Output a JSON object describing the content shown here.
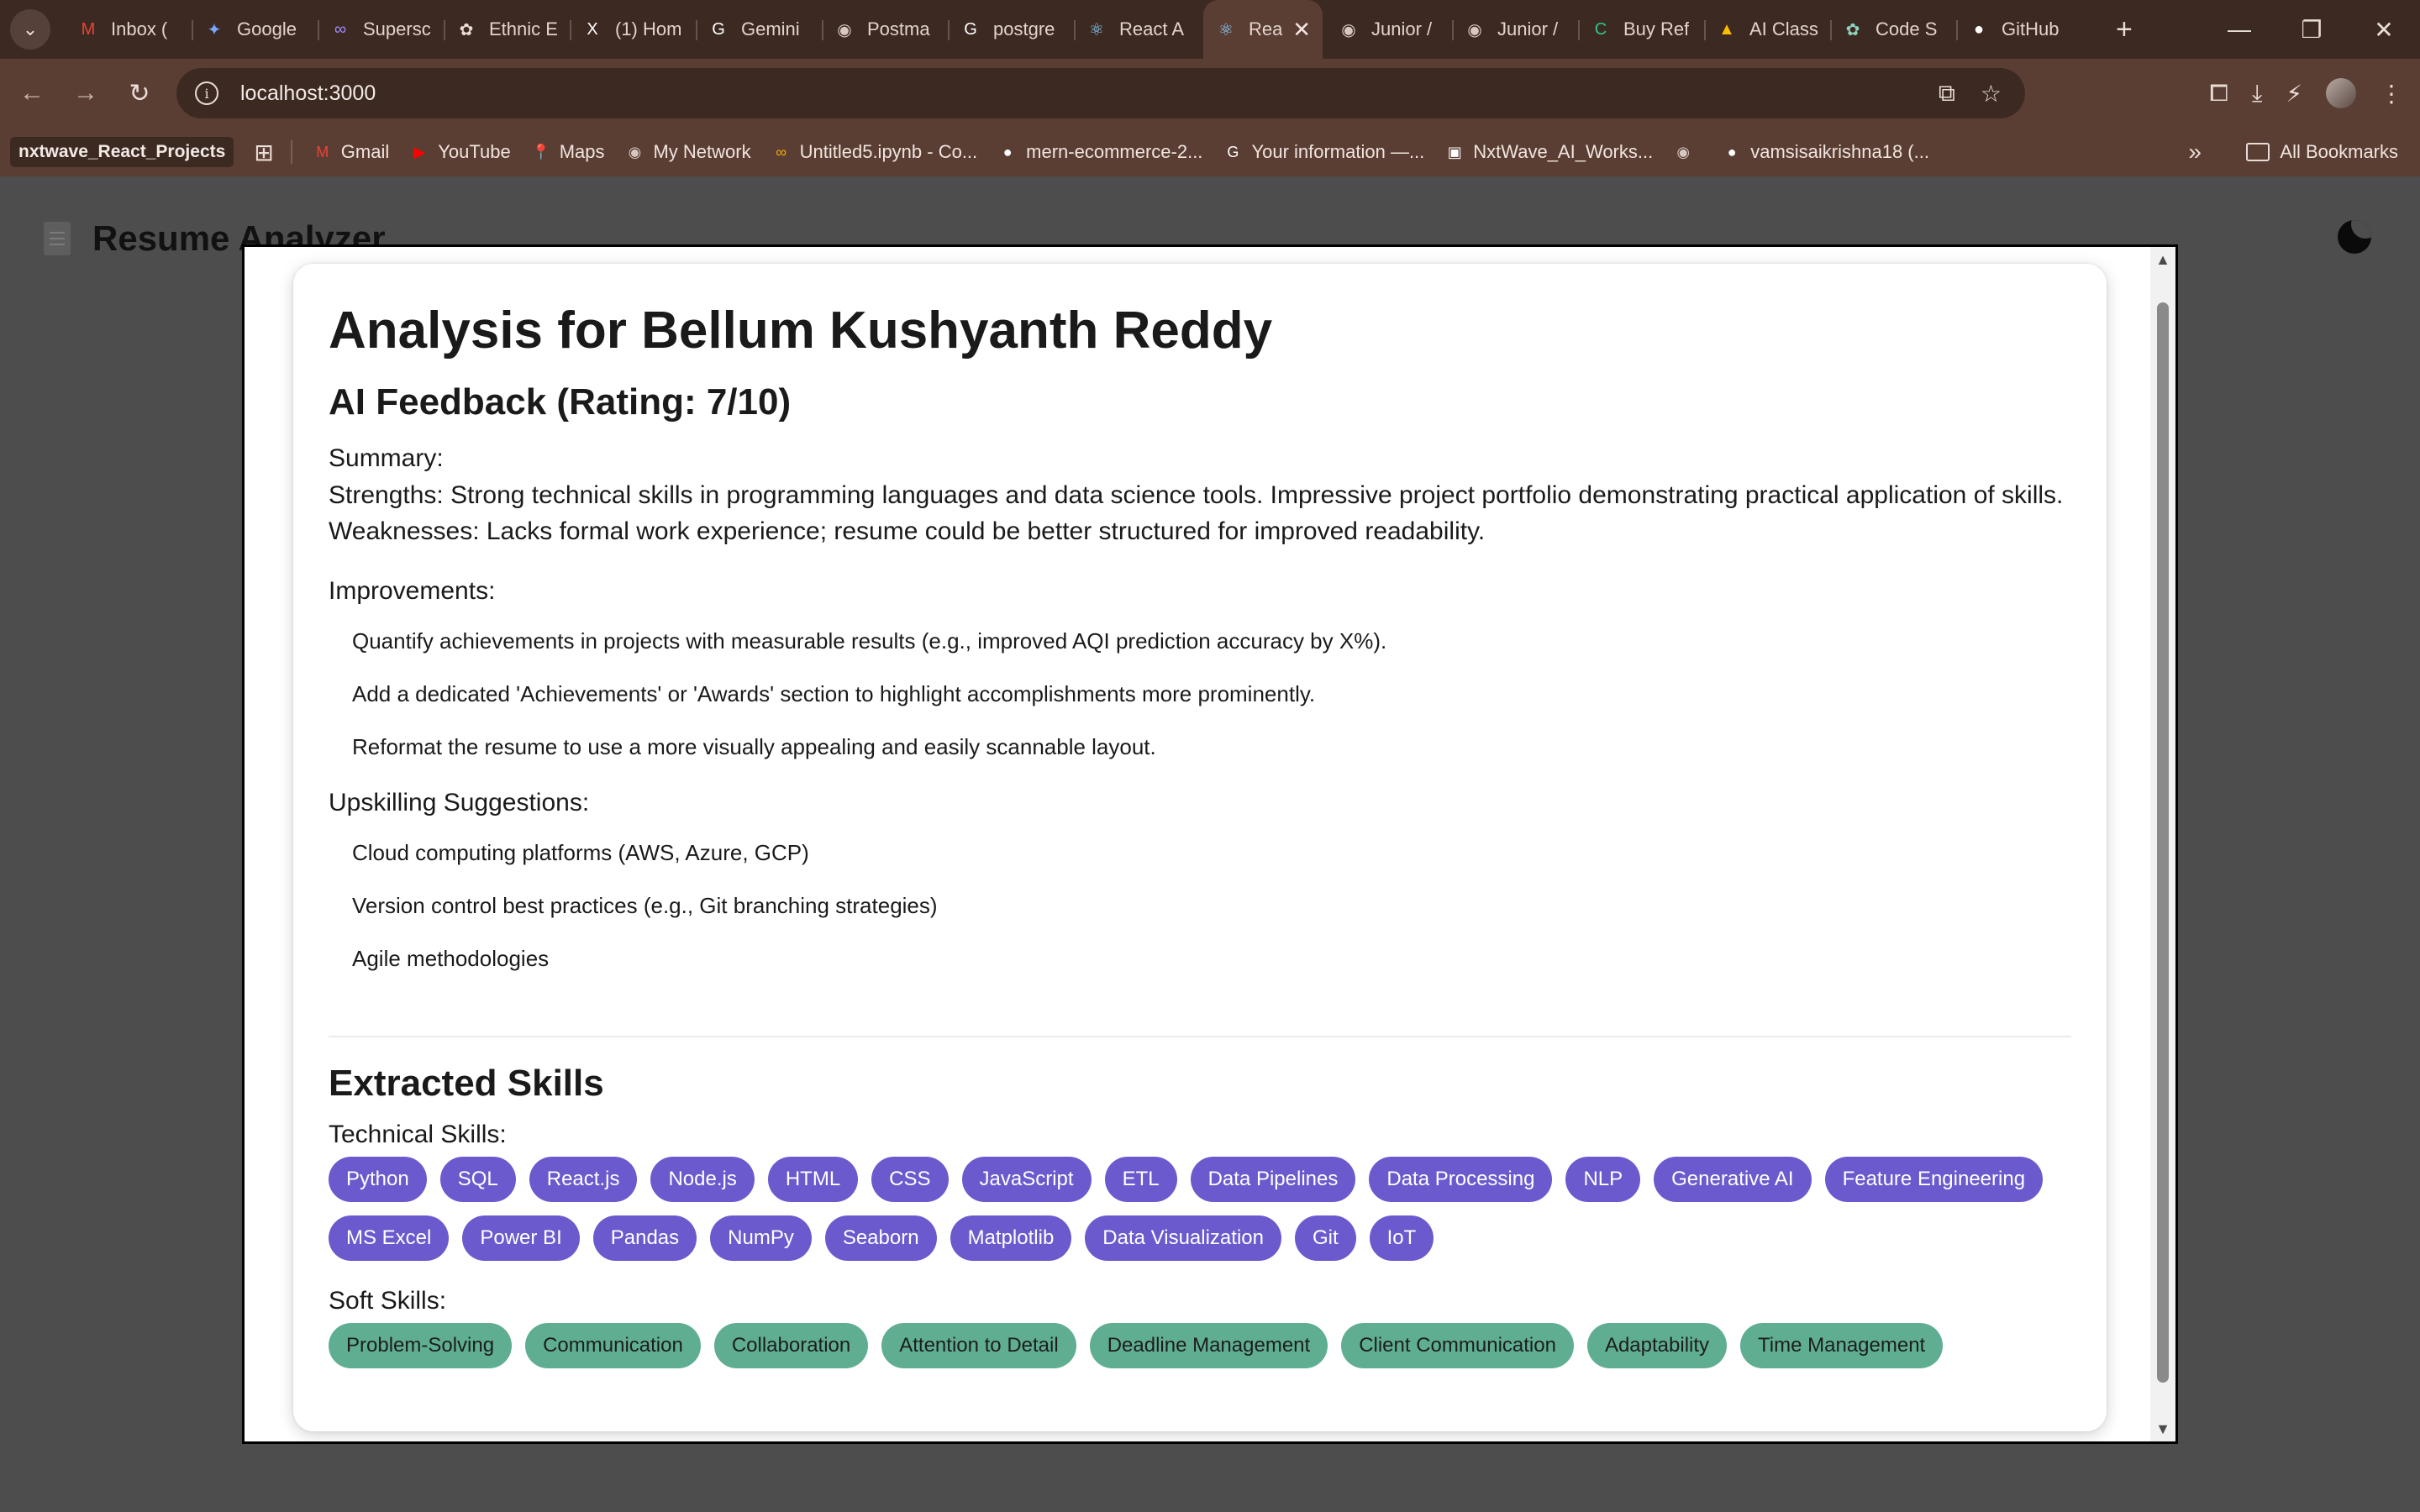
{
  "browser": {
    "tabs": [
      {
        "title": "Inbox (",
        "icon": "gmail-icon",
        "glyph": "M",
        "color": "#ea4335"
      },
      {
        "title": "Google",
        "icon": "gemini-star-icon",
        "glyph": "✦",
        "color": "#7aa7ff"
      },
      {
        "title": "Supersc",
        "icon": "link-icon",
        "glyph": "∞",
        "color": "#9b8cff"
      },
      {
        "title": "Ethnic E",
        "icon": "openai-icon",
        "glyph": "✿",
        "color": "#e9dcd6"
      },
      {
        "title": "(1) Hom",
        "icon": "x-icon",
        "glyph": "X",
        "color": "#ffffff"
      },
      {
        "title": "Gemini",
        "icon": "google-icon",
        "glyph": "G",
        "color": "#ffffff"
      },
      {
        "title": "Postma",
        "icon": "globe-icon",
        "glyph": "◉",
        "color": "#d8c8c1"
      },
      {
        "title": "postgre",
        "icon": "google-icon",
        "glyph": "G",
        "color": "#ffffff"
      },
      {
        "title": "React A",
        "icon": "react-icon",
        "glyph": "⚛",
        "color": "#8fd3ff"
      },
      {
        "title": "Rea",
        "icon": "react-icon",
        "glyph": "⚛",
        "color": "#8fd3ff",
        "active": true
      },
      {
        "title": "Junior /",
        "icon": "globe-icon",
        "glyph": "◉",
        "color": "#d8c8c1"
      },
      {
        "title": "Junior /",
        "icon": "globe-icon",
        "glyph": "◉",
        "color": "#d8c8c1"
      },
      {
        "title": "Buy Ref",
        "icon": "grammarly-icon",
        "glyph": "C",
        "color": "#2fc38e"
      },
      {
        "title": "AI Class",
        "icon": "drive-icon",
        "glyph": "▲",
        "color": "#fbbc04"
      },
      {
        "title": "Code S",
        "icon": "openai-icon",
        "glyph": "✿",
        "color": "#8fd3c0"
      },
      {
        "title": "GitHub",
        "icon": "github-icon",
        "glyph": "●",
        "color": "#ffffff",
        "wide": true
      }
    ],
    "url": "localhost:3000",
    "bookmarks": [
      {
        "title": "Gmail",
        "icon": "gmail-icon",
        "glyph": "M",
        "color": "#ea4335"
      },
      {
        "title": "YouTube",
        "icon": "youtube-icon",
        "glyph": "▶",
        "color": "#ff0000"
      },
      {
        "title": "Maps",
        "icon": "maps-pin-icon",
        "glyph": "📍",
        "color": "#34a853"
      },
      {
        "title": "My Network",
        "icon": "globe-icon",
        "glyph": "◉",
        "color": "#d8c8c1"
      },
      {
        "title": "Untitled5.ipynb - Co...",
        "icon": "colab-icon",
        "glyph": "∞",
        "color": "#f9ab00"
      },
      {
        "title": "mern-ecommerce-2...",
        "icon": "github-icon",
        "glyph": "●",
        "color": "#ffffff"
      },
      {
        "title": "Your information —...",
        "icon": "google-icon",
        "glyph": "G",
        "color": "#ffffff"
      },
      {
        "title": "NxtWave_AI_Works...",
        "icon": "nxtwave-icon",
        "glyph": "▣",
        "color": "#ffffff"
      },
      {
        "title": "",
        "icon": "globe-icon",
        "glyph": "◉",
        "color": "#d8c8c1"
      },
      {
        "title": "vamsisaikrishna18 (...",
        "icon": "github-icon",
        "glyph": "●",
        "color": "#ffffff"
      }
    ],
    "first_bookmark": "nxtwave_React_Projects",
    "all_bookmarks": "All Bookmarks"
  },
  "app": {
    "title": "Resume Analyzer"
  },
  "analysis": {
    "heading": "Analysis for Bellum Kushyanth Reddy",
    "feedback_heading": "AI Feedback (Rating: 7/10)",
    "summary_label": "Summary:",
    "strengths": "Strengths: Strong technical skills in programming languages and data science tools. Impressive project portfolio demonstrating practical application of skills.",
    "weaknesses": "Weaknesses: Lacks formal work experience; resume could be better structured for improved readability.",
    "improvements_label": "Improvements:",
    "improvements": [
      "Quantify achievements in projects with measurable results (e.g., improved AQI prediction accuracy by X%).",
      "Add a dedicated 'Achievements' or 'Awards' section to highlight accomplishments more prominently.",
      "Reformat the resume to use a more visually appealing and easily scannable layout."
    ],
    "upskilling_label": "Upskilling Suggestions:",
    "upskilling": [
      "Cloud computing platforms (AWS, Azure, GCP)",
      "Version control best practices (e.g., Git branching strategies)",
      "Agile methodologies"
    ],
    "skills_heading": "Extracted Skills",
    "technical_label": "Technical Skills:",
    "technical_skills": [
      "Python",
      "SQL",
      "React.js",
      "Node.js",
      "HTML",
      "CSS",
      "JavaScript",
      "ETL",
      "Data Pipelines",
      "Data Processing",
      "NLP",
      "Generative AI",
      "Feature Engineering",
      "MS Excel",
      "Power BI",
      "Pandas",
      "NumPy",
      "Seaborn",
      "Matplotlib",
      "Data Visualization",
      "Git",
      "IoT"
    ],
    "soft_label": "Soft Skills:",
    "soft_skills": [
      "Problem-Solving",
      "Communication",
      "Collaboration",
      "Attention to Detail",
      "Deadline Management",
      "Client Communication",
      "Adaptability",
      "Time Management"
    ]
  },
  "colors": {
    "technical_chip": "#6a5acd",
    "soft_chip": "#5fae92",
    "overlay": "#4d4d4d",
    "chrome_frame": "#3c2a22"
  }
}
